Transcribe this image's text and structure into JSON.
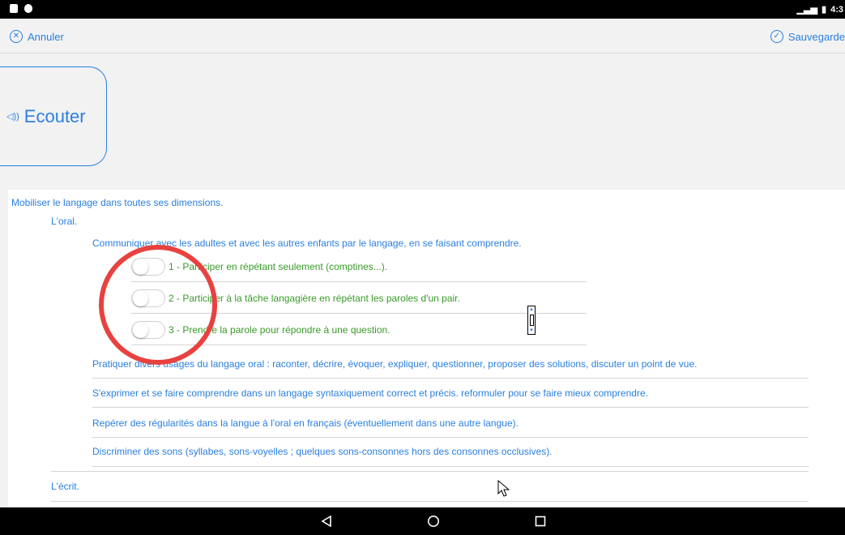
{
  "status_bar": {
    "time": "4:3",
    "signal": "▁▃▅",
    "battery": "▮"
  },
  "top_bar": {
    "cancel_label": "Annuler",
    "save_label": "Sauvegarde"
  },
  "listen_card": {
    "label": "Ecouter",
    "icon": "speaker-icon"
  },
  "section_title": "Mobiliser le langage dans toutes ses dimensions.",
  "subsection_oral": "L'oral.",
  "objective_1": "Communiquer avec les adultes et avec les autres enfants par le langage, en se faisant comprendre.",
  "levels": [
    {
      "label": "1 - Participer en répétant seulement (comptines...).",
      "checked": false
    },
    {
      "label": "2 - Participer à la tâche langagière en répétant les paroles d'un pair.",
      "checked": false
    },
    {
      "label": "3 - Prendre la parole pour répondre à une question.",
      "checked": false
    }
  ],
  "objectives_more": [
    "Pratiquer divers usages du langage oral : raconter, décrire, évoquer, expliquer, questionner, proposer des solutions, discuter un point de vue.",
    "S'exprimer et se faire comprendre dans un langage syntaxiquement correct et précis. reformuler pour se faire mieux comprendre.",
    "Repérer des régularités dans la langue à l'oral en français (éventuellement dans une autre langue).",
    "Discriminer des sons (syllabes, sons-voyelles ; quelques sons-consonnes hors des consonnes occlusives)."
  ],
  "subsection_ecrit": "L'écrit.",
  "colors": {
    "accent": "#2a7fe0",
    "level_text": "#3a9a2a",
    "annotation": "#e8423f"
  }
}
